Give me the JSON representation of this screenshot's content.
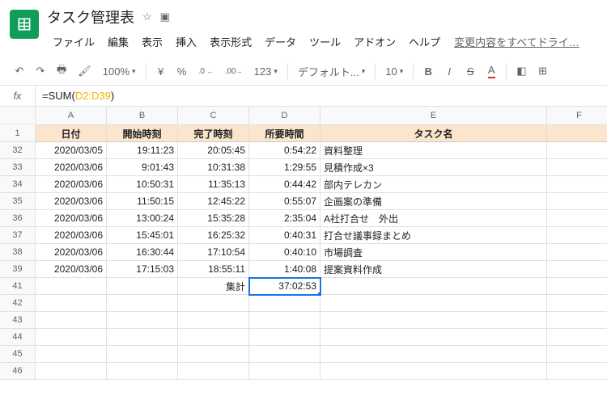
{
  "doc": {
    "title": "タスク管理表"
  },
  "menu": {
    "file": "ファイル",
    "edit": "編集",
    "view": "表示",
    "insert": "挿入",
    "format": "表示形式",
    "data": "データ",
    "tools": "ツール",
    "addons": "アドオン",
    "help": "ヘルプ",
    "save_status": "変更内容をすべてドライ…"
  },
  "toolbar": {
    "zoom": "100%",
    "yen": "¥",
    "pct": "%",
    "dec_dec": ".0",
    "dec_inc": ".00",
    "num_format": "123",
    "font": "デフォルト...",
    "font_size": "10",
    "bold": "B",
    "italic": "I",
    "strike": "S",
    "text_color": "A"
  },
  "formula": {
    "prefix": "=SUM(",
    "range": "D2:D39",
    "suffix": ")"
  },
  "cols": [
    "A",
    "B",
    "C",
    "D",
    "E",
    "F"
  ],
  "header_row_num": "1",
  "headers": {
    "A": "日付",
    "B": "開始時刻",
    "C": "完了時刻",
    "D": "所要時間",
    "E": "タスク名"
  },
  "rows": [
    {
      "n": "32",
      "A": "2020/03/05",
      "B": "19:11:23",
      "C": "20:05:45",
      "D": "0:54:22",
      "E": "資料整理"
    },
    {
      "n": "33",
      "A": "2020/03/06",
      "B": "9:01:43",
      "C": "10:31:38",
      "D": "1:29:55",
      "E": "見積作成×3"
    },
    {
      "n": "34",
      "A": "2020/03/06",
      "B": "10:50:31",
      "C": "11:35:13",
      "D": "0:44:42",
      "E": "部内テレカン"
    },
    {
      "n": "35",
      "A": "2020/03/06",
      "B": "11:50:15",
      "C": "12:45:22",
      "D": "0:55:07",
      "E": "企画案の準備"
    },
    {
      "n": "36",
      "A": "2020/03/06",
      "B": "13:00:24",
      "C": "15:35:28",
      "D": "2:35:04",
      "E": "A社打合せ　外出"
    },
    {
      "n": "37",
      "A": "2020/03/06",
      "B": "15:45:01",
      "C": "16:25:32",
      "D": "0:40:31",
      "E": "打合せ議事録まとめ"
    },
    {
      "n": "38",
      "A": "2020/03/06",
      "B": "16:30:44",
      "C": "17:10:54",
      "D": "0:40:10",
      "E": "市場調査"
    },
    {
      "n": "39",
      "A": "2020/03/06",
      "B": "17:15:03",
      "C": "18:55:11",
      "D": "1:40:08",
      "E": "提案資料作成"
    }
  ],
  "summary": {
    "row_num": "41",
    "label": "集計",
    "value": "37:02:53"
  },
  "empty_rows": [
    "42",
    "43",
    "44",
    "45",
    "46"
  ],
  "chart_data": {
    "type": "table",
    "title": "タスク管理表",
    "columns": [
      "日付",
      "開始時刻",
      "完了時刻",
      "所要時間",
      "タスク名"
    ],
    "rows": [
      [
        "2020/03/05",
        "19:11:23",
        "20:05:45",
        "0:54:22",
        "資料整理"
      ],
      [
        "2020/03/06",
        "9:01:43",
        "10:31:38",
        "1:29:55",
        "見積作成×3"
      ],
      [
        "2020/03/06",
        "10:50:31",
        "11:35:13",
        "0:44:42",
        "部内テレカン"
      ],
      [
        "2020/03/06",
        "11:50:15",
        "12:45:22",
        "0:55:07",
        "企画案の準備"
      ],
      [
        "2020/03/06",
        "13:00:24",
        "15:35:28",
        "2:35:04",
        "A社打合せ　外出"
      ],
      [
        "2020/03/06",
        "15:45:01",
        "16:25:32",
        "0:40:31",
        "打合せ議事録まとめ"
      ],
      [
        "2020/03/06",
        "16:30:44",
        "17:10:54",
        "0:40:10",
        "市場調査"
      ],
      [
        "2020/03/06",
        "17:15:03",
        "18:55:11",
        "1:40:08",
        "提案資料作成"
      ]
    ],
    "aggregate": {
      "label": "集計",
      "sum_duration": "37:02:53",
      "formula": "=SUM(D2:D39)"
    }
  }
}
